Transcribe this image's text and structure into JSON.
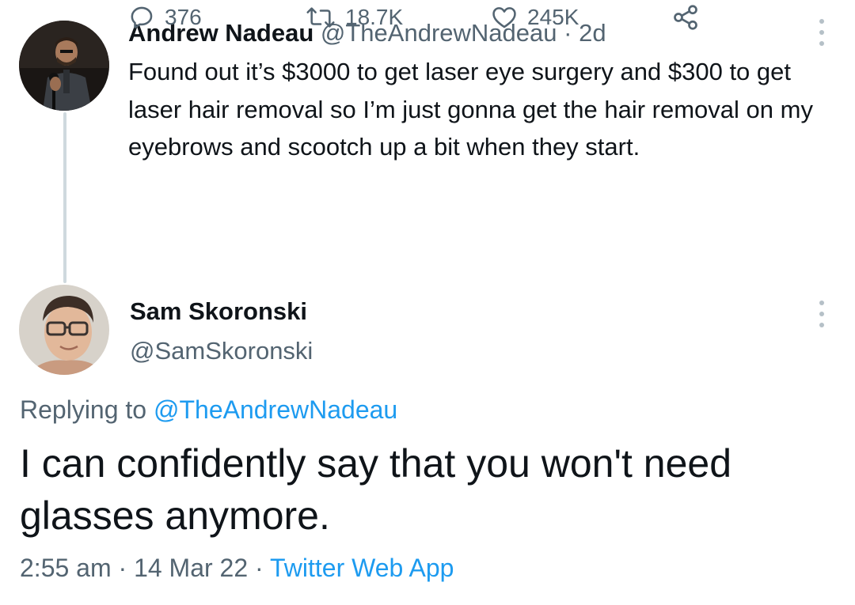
{
  "original_tweet": {
    "author_name": "Andrew Nadeau",
    "author_handle": "@TheAndrewNadeau",
    "separator": "·",
    "time_ago": "2d",
    "text": "Found out it’s $3000 to get laser eye surgery and $300 to get laser hair removal so I’m just gonna get the hair removal on my eyebrows and scootch up a bit when they start.",
    "actions": {
      "reply_count": "376",
      "retweet_count": "18.7K",
      "like_count": "245K"
    },
    "icons": {
      "reply": "reply-icon",
      "retweet": "retweet-icon",
      "like": "heart-icon",
      "share": "share-icon",
      "more": "more-icon"
    }
  },
  "reply_tweet": {
    "author_name": "Sam Skoronski",
    "author_handle": "@SamSkoronski",
    "replying_prefix": "Replying to",
    "replying_to": "@TheAndrewNadeau",
    "text": "I can confidently say that you won't need glasses anymore.",
    "time": "2:55 am",
    "date": "14 Mar 22",
    "separator": "·",
    "source": "Twitter Web App"
  },
  "colors": {
    "link": "#1d9bf0",
    "muted": "#536471",
    "text": "#0f1419",
    "thread_line": "#cfd9de"
  }
}
